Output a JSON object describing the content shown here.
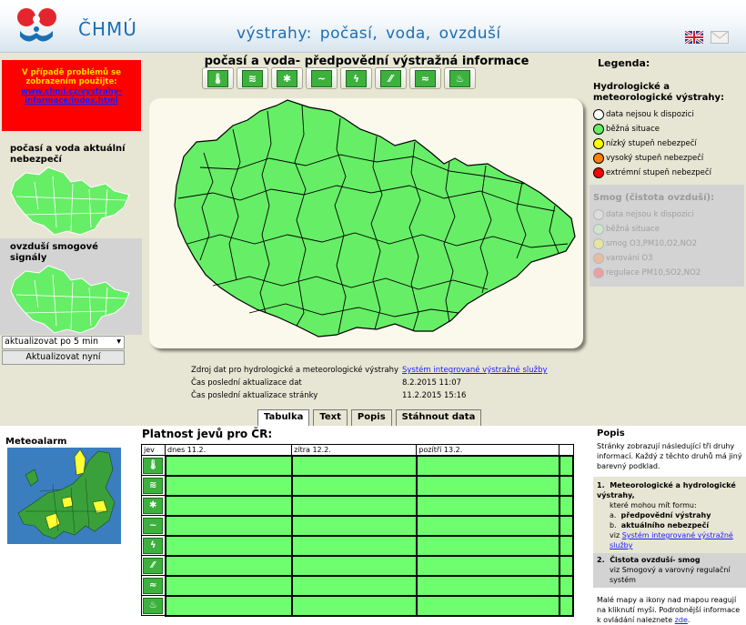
{
  "header": {
    "logo_text": "ČHMÚ",
    "title": "výstrahy: počasí, voda, ovzduší",
    "flag_icon": "uk-flag-icon",
    "mail_icon": "mail-icon"
  },
  "sidebar": {
    "alert_text": "V případě problémů se zobrazením použijte:",
    "alert_link": "www.chmi.cz/vystrahy-informace/index.html",
    "weather_title": "počasí a voda aktuální nebezpečí",
    "smog_title": "ovzduší smogové signály",
    "refresh_select_value": "aktualizovat po 5 min",
    "refresh_button": "Aktualizovat nyní"
  },
  "center": {
    "title": "počasí a voda- předpovědní výstražná informace",
    "icons": [
      {
        "name": "temperature-icon",
        "glyph": "🌡"
      },
      {
        "name": "wind-icon",
        "glyph": "≋"
      },
      {
        "name": "snow-icon",
        "glyph": "✱"
      },
      {
        "name": "snow-drift-icon",
        "glyph": "~"
      },
      {
        "name": "lightning-icon",
        "glyph": "ϟ"
      },
      {
        "name": "rain-icon",
        "glyph": "⁄⁄"
      },
      {
        "name": "flood-icon",
        "glyph": "≈"
      },
      {
        "name": "fire-icon",
        "glyph": "♨"
      }
    ],
    "source_label": "Zdroj dat pro hydrologické a meteorologické výstrahy",
    "source_link": "Systém integrované výstražné služby",
    "data_update_label": "Čas poslední aktualizace dat",
    "data_update_value": "8.2.2015 11:07",
    "page_update_label": "Čas poslední aktualizace stránky",
    "page_update_value": "11.2.2015 15:16"
  },
  "tabs": [
    "Tabulka",
    "Text",
    "Popis",
    "Stáhnout data"
  ],
  "legend": {
    "title": "Legenda:",
    "hydro_title": "Hydrologické a meteorologické výstrahy:",
    "hydro_items": [
      {
        "label": "data nejsou k dispozici",
        "color": "#ffffff"
      },
      {
        "label": "běžná situace",
        "color": "#66ee66"
      },
      {
        "label": "nízký stupeň nebezpečí",
        "color": "#ffff00"
      },
      {
        "label": "vysoký stupeň nebezpečí",
        "color": "#ff8000"
      },
      {
        "label": "extrémní stupeň nebezpečí",
        "color": "#ff0000"
      }
    ],
    "smog_title": "Smog (čistota ovzduší):",
    "smog_items": [
      {
        "label": "data nejsou k dispozici",
        "color": "#dcdcdc"
      },
      {
        "label": "běžná situace",
        "color": "#cde6cd"
      },
      {
        "label": "smog O3,PM10,O2,NO2",
        "color": "#e6e6a0"
      },
      {
        "label": "varování O3",
        "color": "#e8bca0"
      },
      {
        "label": "regulace PM10,SO2,NO2",
        "color": "#e8a0a0"
      }
    ]
  },
  "meteoalarm": {
    "title": "Meteoalarm"
  },
  "validity": {
    "title": "Platnost jevů pro ČR:",
    "col_phenomenon": "jev",
    "col_today": "dnes 11.2.",
    "col_tomorrow": "zítra 12.2.",
    "col_after": "pozítří 13.2.",
    "status_color": "#6dff6d"
  },
  "popis": {
    "title": "Popis",
    "intro": "Stránky zobrazují následující tři druhy informací. Každý z těchto druhů má jiný barevný podklad.",
    "item1_title": "Meteorologické a hydrologické výstrahy,",
    "item1_sub": "které mohou mít formu:",
    "item1_a": "předpovědní výstrahy",
    "item1_b": "aktuálního nebezpečí",
    "item1_see": "viz",
    "item1_link": "Systém integrované výstražné služby",
    "item2_title": "Čistota ovzduší- smog",
    "item2_text": "viz Smogový a varovný regulační systém",
    "footer": "Malé mapy a ikony nad mapou reagují na kliknutí myši. Podrobnější informace k ovládání naleznete",
    "footer_link": "zde"
  }
}
